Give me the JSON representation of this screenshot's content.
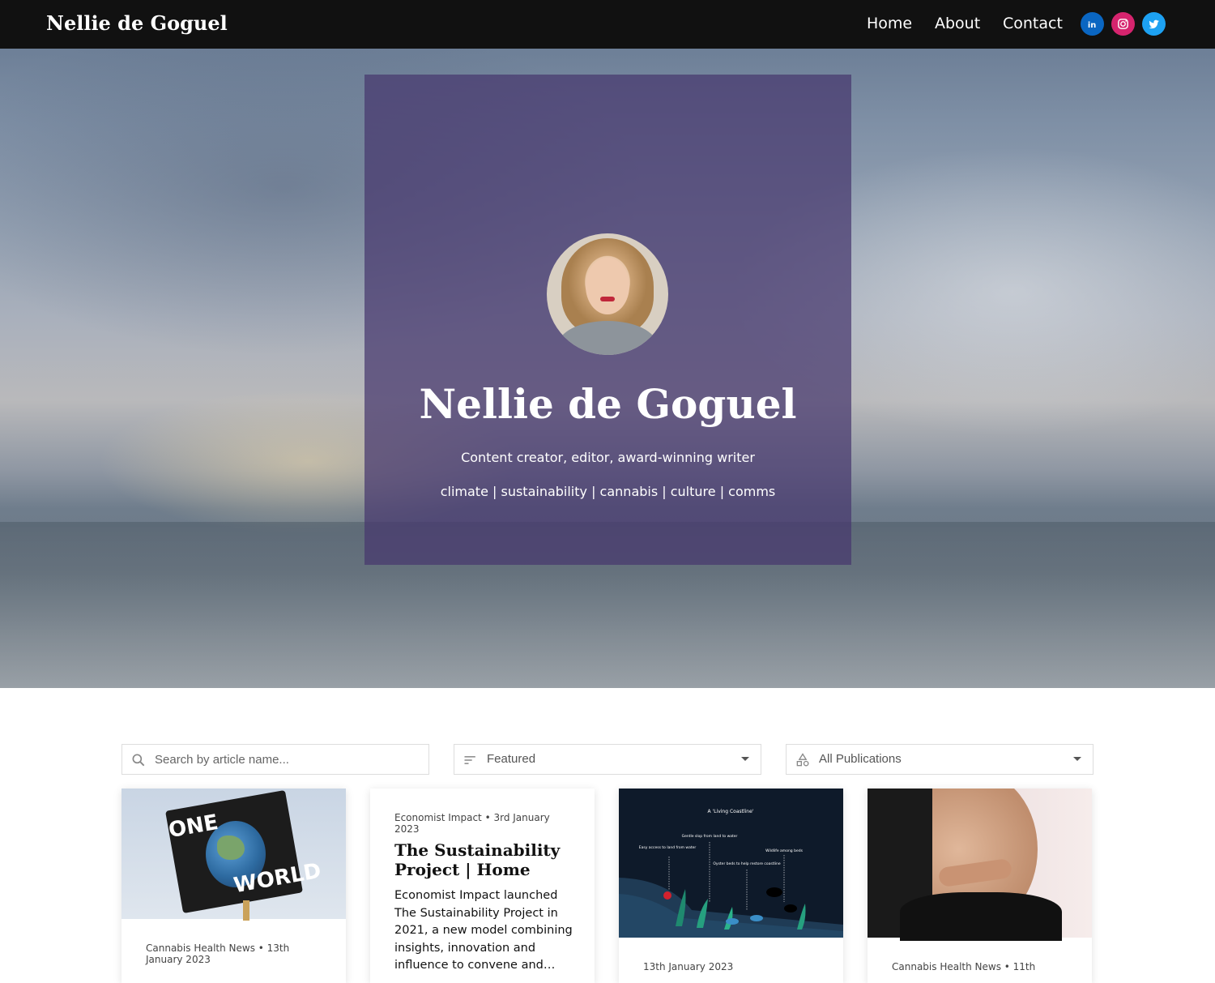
{
  "header": {
    "brand": "Nellie de Goguel",
    "nav": [
      "Home",
      "About",
      "Contact"
    ],
    "social": [
      {
        "name": "linkedin",
        "color": "#0a66c2",
        "icon": "linkedin-icon"
      },
      {
        "name": "instagram",
        "color": "#d6246e",
        "icon": "instagram-icon"
      },
      {
        "name": "twitter",
        "color": "#1da1f2",
        "icon": "twitter-icon"
      }
    ]
  },
  "hero": {
    "name": "Nellie de Goguel",
    "tagline": "Content creator, editor, award-winning writer",
    "topics": "climate | sustainability | cannabis | culture | comms",
    "overlay_color": "#46376e"
  },
  "filters": {
    "search_placeholder": "Search by article name...",
    "sort_value": "Featured",
    "publication_value": "All Publications"
  },
  "cards": [
    {
      "meta": "Cannabis Health News • 13th January 2023",
      "thumb": "one-world-protest-sign"
    },
    {
      "meta": "Economist Impact • 3rd January 2023",
      "title": "The Sustainability Project | Home",
      "description": "Economist Impact launched The Sustainability Project in 2021, a new model combining insights, innovation and influence to convene and…"
    },
    {
      "meta": "13th January 2023",
      "thumb": "living-coastline-infographic",
      "thumb_text": {
        "title": "A 'Living Coastline'",
        "labels": [
          "Easy access to land from water",
          "Gentle slop from land to water",
          "Oyster beds to help restore coastline",
          "Wildlife among beds"
        ]
      }
    },
    {
      "meta": "Cannabis Health News • 11th",
      "thumb": "pregnant-belly-photo"
    }
  ]
}
